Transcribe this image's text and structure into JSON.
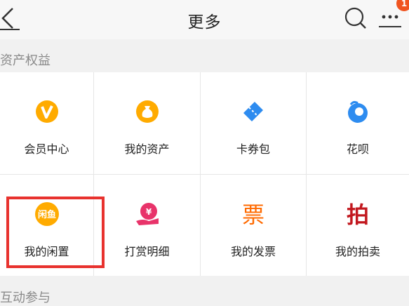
{
  "header": {
    "title": "更多",
    "notification_count": "1"
  },
  "sections": [
    {
      "title": "资产权益"
    },
    {
      "title": "互动参与"
    }
  ],
  "grid": {
    "items": [
      {
        "label": "会员中心",
        "icon": "vip-v-icon"
      },
      {
        "label": "我的资产",
        "icon": "money-bag-icon"
      },
      {
        "label": "卡券包",
        "icon": "ticket-icon"
      },
      {
        "label": "花呗",
        "icon": "huabei-icon"
      },
      {
        "label": "我的闲置",
        "icon": "xianyu-icon",
        "icon_text": "闲鱼"
      },
      {
        "label": "打赏明细",
        "icon": "reward-hand-icon",
        "icon_text": "¥"
      },
      {
        "label": "我的发票",
        "icon": "invoice-piao-icon",
        "icon_text": "票"
      },
      {
        "label": "我的拍卖",
        "icon": "auction-pai-icon",
        "icon_text": "拍"
      }
    ]
  },
  "colors": {
    "orange": "#ffab00",
    "blue": "#2e8cf0",
    "auction": "#c2181f",
    "invoice": "#ff6a00",
    "pink": "#e8336a",
    "highlight": "#e8322e"
  }
}
